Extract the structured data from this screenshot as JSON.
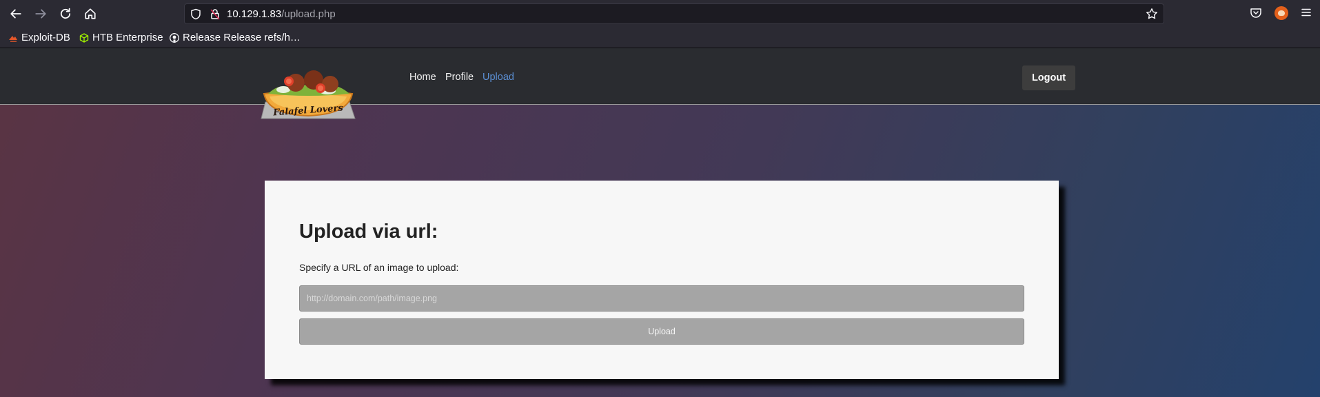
{
  "browser": {
    "url_host": "10.129.1.83",
    "url_path": "/upload.php",
    "bookmarks": [
      {
        "label": "Exploit-DB",
        "icon": "exploit-db-icon"
      },
      {
        "label": "HTB Enterprise",
        "icon": "htb-cube-icon"
      },
      {
        "label": "Release Release refs/h…",
        "icon": "github-icon"
      }
    ]
  },
  "site": {
    "logo_text": "Falafel Lovers",
    "nav": [
      {
        "label": "Home",
        "active": false
      },
      {
        "label": "Profile",
        "active": false
      },
      {
        "label": "Upload",
        "active": true
      }
    ],
    "logout_label": "Logout"
  },
  "upload": {
    "title": "Upload via url:",
    "hint": "Specify a URL of an image to upload:",
    "input_placeholder": "http://domain.com/path/image.png",
    "input_value": "",
    "button_label": "Upload"
  },
  "colors": {
    "nav_active": "#5b8fd4",
    "card_bg": "#f7f7f7",
    "header_bg": "#2a2c30"
  }
}
